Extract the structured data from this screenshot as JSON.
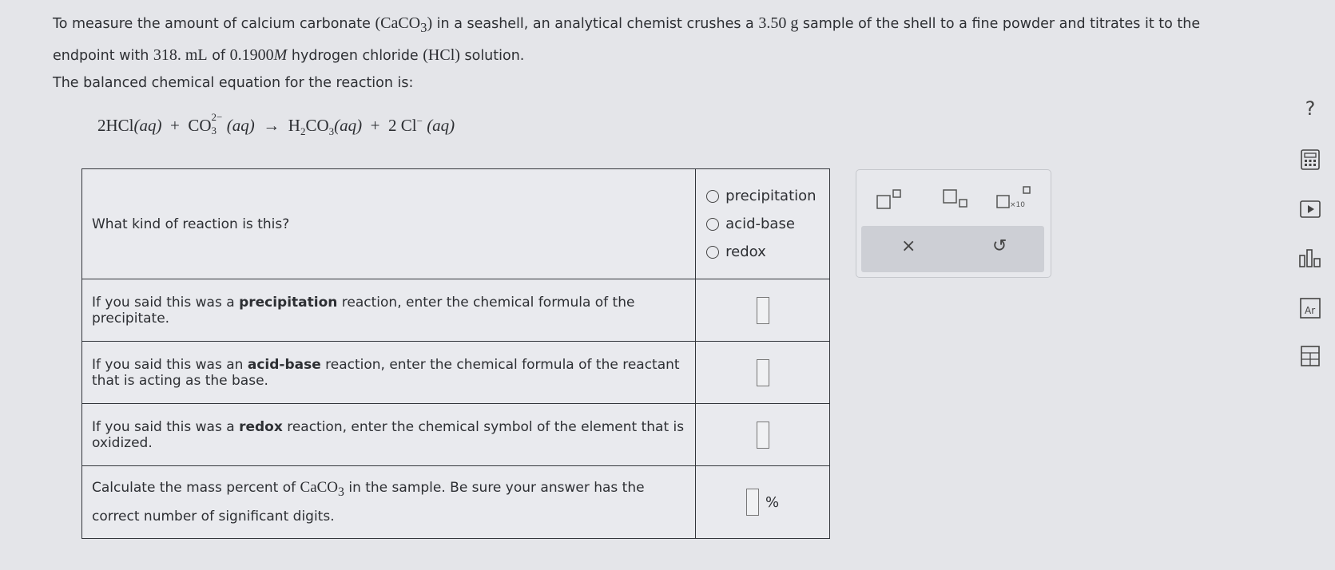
{
  "intro": {
    "p1a": "To measure the amount of calcium carbonate ",
    "caco3_open": "(CaCO",
    "caco3_sub": "3",
    "caco3_close": ")",
    "p1b": " in a seashell, an analytical chemist crushes a ",
    "mass": "3.50 g",
    "p1c": " sample of the shell to a fine powder and titrates it to the endpoint with ",
    "volume": "318. mL",
    "p1d": " of ",
    "conc": "0.1900",
    "conc_unit": "M",
    "p1e": " hydrogen chloride ",
    "hcl": "(HCl)",
    "p1f": " solution."
  },
  "equation_label": "The balanced chemical equation for the reaction is:",
  "equation": {
    "t1": "2HCl",
    "aq": "(aq)",
    "plus": "+",
    "co": "CO",
    "co_sup": "2−",
    "co_sub": "3",
    "arrow": "→",
    "h": "H",
    "h_sub": "2",
    "co2": "CO",
    "co2_sub": "3",
    "cl": "2 Cl",
    "cl_sup": "−"
  },
  "table": {
    "q0": "What kind of reaction is this?",
    "options": [
      "precipitation",
      "acid-base",
      "redox"
    ],
    "q1a": "If you said this was a ",
    "q1b": "precipitation",
    "q1c": " reaction, enter the chemical formula of the precipitate.",
    "q2a": "If you said this was an ",
    "q2b": "acid-base",
    "q2c": " reaction, enter the chemical formula of the reactant that is acting as the base.",
    "q3a": "If you said this was a ",
    "q3b": "redox",
    "q3c": " reaction, enter the chemical symbol of the element that is oxidized.",
    "q4a": "Calculate the mass percent of ",
    "q4b": "CaCO",
    "q4sub": "3",
    "q4c": " in the sample. Be sure your answer has the correct number of significant digits.",
    "pct": "%"
  },
  "toolpanel": {
    "x10": "×10",
    "clear": "×",
    "undo": "↺"
  },
  "rightbar": {
    "help": "?"
  }
}
